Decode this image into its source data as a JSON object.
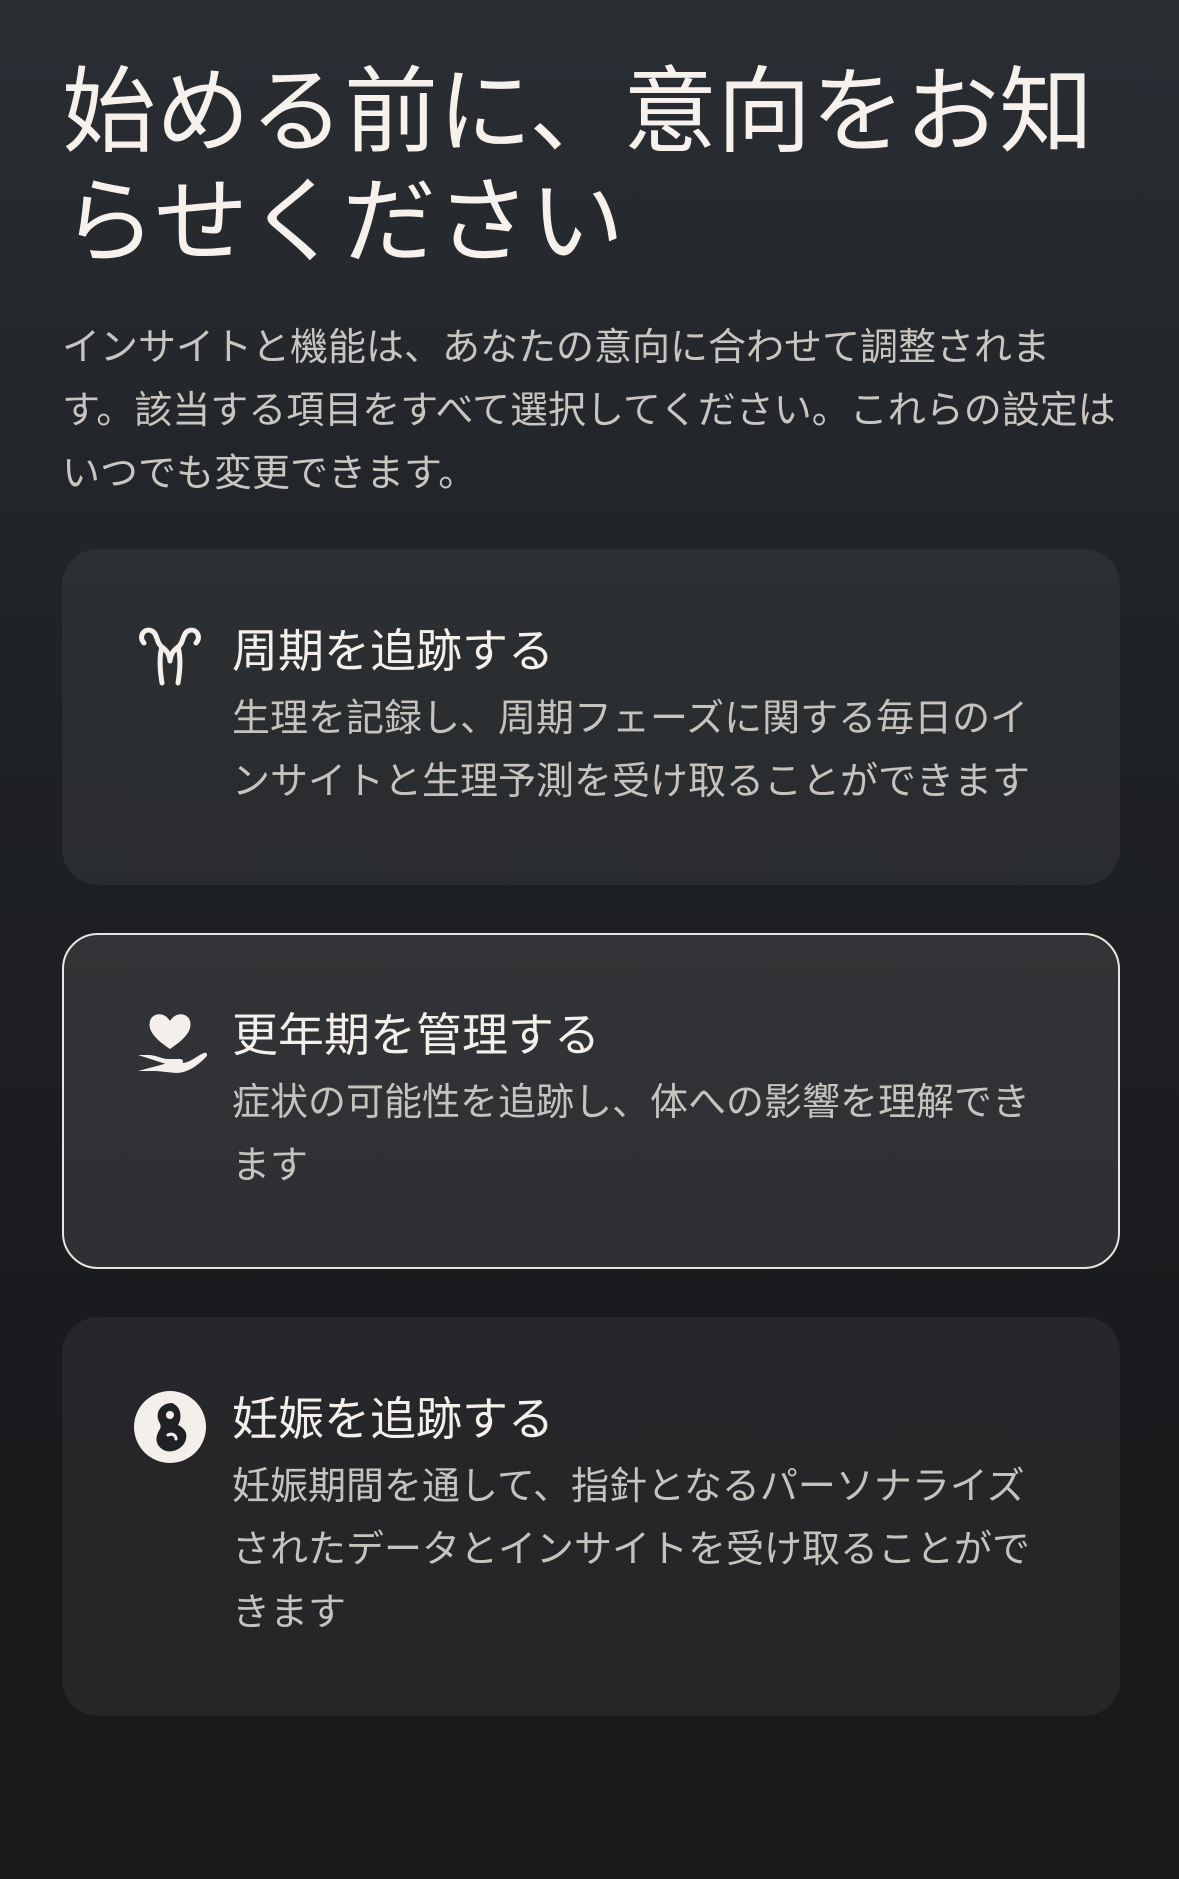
{
  "page": {
    "title": "始める前に、意向をお知らせください",
    "intro": "インサイトと機能は、あなたの意向に合わせて調整されます。該当する項目をすべて選択してください。これらの設定はいつでも変更できます。"
  },
  "options": [
    {
      "title": "周期を追跡する",
      "description": "生理を記録し、周期フェーズに関する毎日のインサイトと生理予測を受け取ることができます",
      "icon": "uterus-icon",
      "selected": false
    },
    {
      "title": "更年期を管理する",
      "description": "症状の可能性を追跡し、体への影響を理解できます",
      "icon": "heart-in-hand-icon",
      "selected": true
    },
    {
      "title": "妊娠を追跡する",
      "description": "妊娠期間を通して、指針となるパーソナライズされたデータとインサイトを受け取ることができます",
      "icon": "fetus-icon",
      "selected": false
    }
  ],
  "colors": {
    "selected_border": "#e9e4df",
    "icon": "#f4efea"
  }
}
